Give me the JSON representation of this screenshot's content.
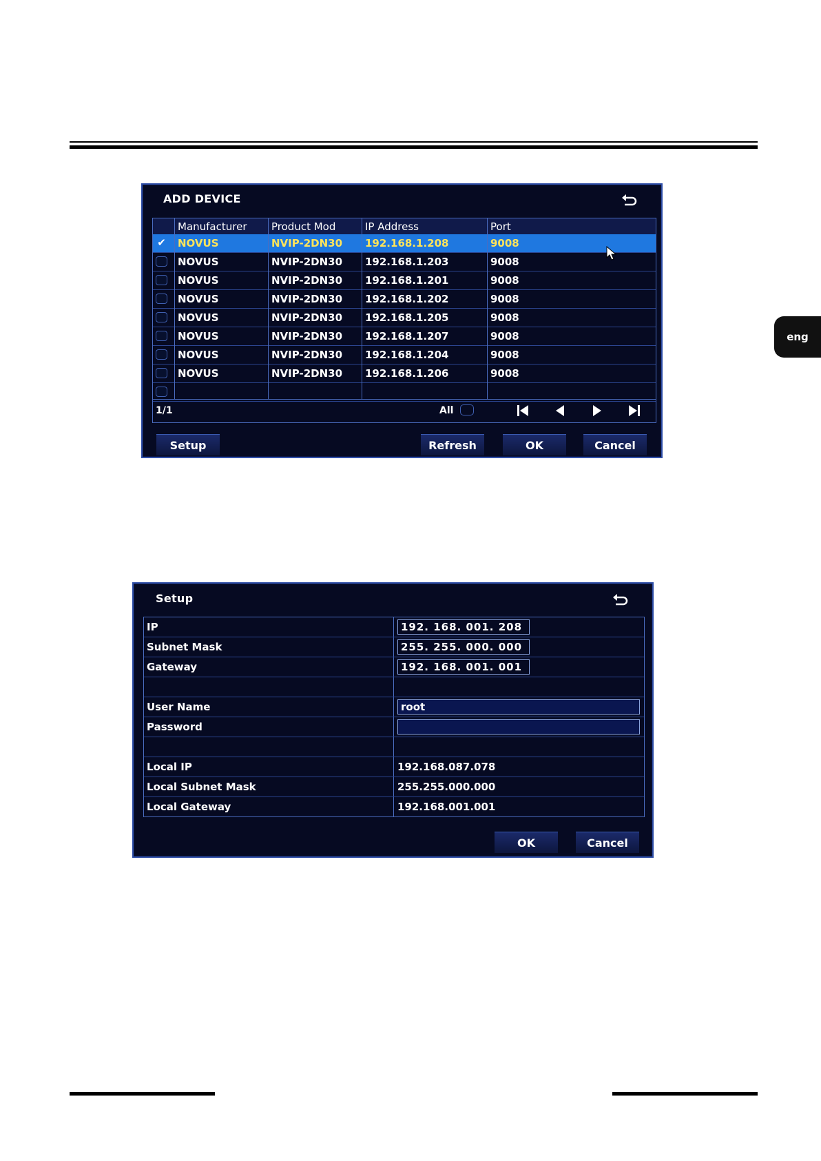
{
  "language_tab": "eng",
  "add_device": {
    "title": "ADD DEVICE",
    "columns": [
      "Manufacturer",
      "Product Mod",
      "IP Address",
      "Port"
    ],
    "rows": [
      {
        "manufacturer": "NOVUS",
        "product": "NVIP-2DN30",
        "ip": "192.168.1.208",
        "port": "9008",
        "checked": true,
        "selected": true
      },
      {
        "manufacturer": "NOVUS",
        "product": "NVIP-2DN30",
        "ip": "192.168.1.203",
        "port": "9008",
        "checked": false,
        "selected": false
      },
      {
        "manufacturer": "NOVUS",
        "product": "NVIP-2DN30",
        "ip": "192.168.1.201",
        "port": "9008",
        "checked": false,
        "selected": false
      },
      {
        "manufacturer": "NOVUS",
        "product": "NVIP-2DN30",
        "ip": "192.168.1.202",
        "port": "9008",
        "checked": false,
        "selected": false
      },
      {
        "manufacturer": "NOVUS",
        "product": "NVIP-2DN30",
        "ip": "192.168.1.205",
        "port": "9008",
        "checked": false,
        "selected": false
      },
      {
        "manufacturer": "NOVUS",
        "product": "NVIP-2DN30",
        "ip": "192.168.1.207",
        "port": "9008",
        "checked": false,
        "selected": false
      },
      {
        "manufacturer": "NOVUS",
        "product": "NVIP-2DN30",
        "ip": "192.168.1.204",
        "port": "9008",
        "checked": false,
        "selected": false
      },
      {
        "manufacturer": "NOVUS",
        "product": "NVIP-2DN30",
        "ip": "192.168.1.206",
        "port": "9008",
        "checked": false,
        "selected": false
      }
    ],
    "page": "1/1",
    "all_label": "All",
    "buttons": {
      "setup": "Setup",
      "refresh": "Refresh",
      "ok": "OK",
      "cancel": "Cancel"
    }
  },
  "setup": {
    "title": "Setup",
    "ip_label": "IP",
    "ip_value": "192. 168. 001. 208",
    "subnet_label": "Subnet Mask",
    "subnet_value": "255. 255. 000. 000",
    "gateway_label": "Gateway",
    "gateway_value": "192. 168. 001. 001",
    "username_label": "User Name",
    "username_value": "root",
    "password_label": "Password",
    "password_value": "",
    "local_ip_label": "Local IP",
    "local_ip_value": "192.168.087.078",
    "local_subnet_label": "Local Subnet Mask",
    "local_subnet_value": "255.255.000.000",
    "local_gateway_label": "Local Gateway",
    "local_gateway_value": "192.168.001.001",
    "buttons": {
      "ok": "OK",
      "cancel": "Cancel"
    }
  },
  "colors": {
    "panel_bg": "#060a22",
    "selected_row": "#1f78e0",
    "selected_text": "#ffe45a",
    "border": "#4a6cc0"
  }
}
